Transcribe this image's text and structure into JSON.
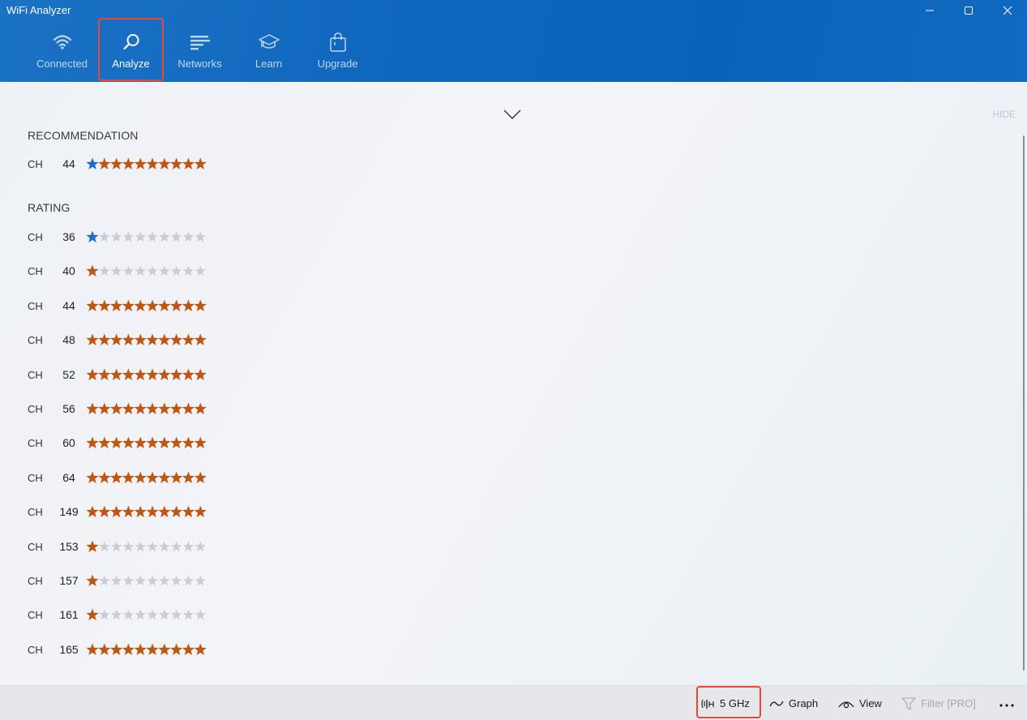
{
  "app": {
    "title": "WiFi Analyzer"
  },
  "window_controls": {
    "minimize_icon": "minimize-icon",
    "maximize_icon": "maximize-icon",
    "close_icon": "close-icon"
  },
  "nav": {
    "items": [
      {
        "label": "Connected",
        "icon": "wifi-icon"
      },
      {
        "label": "Analyze",
        "icon": "magnifier-icon",
        "active": true
      },
      {
        "label": "Networks",
        "icon": "networks-icon"
      },
      {
        "label": "Learn",
        "icon": "mortarboard-icon"
      },
      {
        "label": "Upgrade",
        "icon": "shopping-bag-icon"
      }
    ]
  },
  "content": {
    "hide_label": "HIDE",
    "recommendation": {
      "title": "RECOMMENDATION",
      "ch_label": "CH",
      "channel": "44",
      "rating": 10
    },
    "rating": {
      "title": "RATING",
      "ch_label": "CH",
      "rows": [
        {
          "channel": "36",
          "rating": 1
        },
        {
          "channel": "40",
          "rating": 1
        },
        {
          "channel": "44",
          "rating": 10
        },
        {
          "channel": "48",
          "rating": 10
        },
        {
          "channel": "52",
          "rating": 10
        },
        {
          "channel": "56",
          "rating": 10
        },
        {
          "channel": "60",
          "rating": 10
        },
        {
          "channel": "64",
          "rating": 10
        },
        {
          "channel": "149",
          "rating": 10
        },
        {
          "channel": "153",
          "rating": 1
        },
        {
          "channel": "157",
          "rating": 1
        },
        {
          "channel": "161",
          "rating": 1
        },
        {
          "channel": "165",
          "rating": 10
        }
      ]
    },
    "max_stars": 10
  },
  "bottom_bar": {
    "band": {
      "label": "5 GHz",
      "icon": "antenna-icon"
    },
    "graph": {
      "label": "Graph",
      "icon": "graph-wave-icon"
    },
    "view": {
      "label": "View",
      "icon": "eye-icon"
    },
    "filter": {
      "label": "Filter [PRO]",
      "icon": "filter-icon"
    },
    "more": {
      "icon": "more-dots-icon"
    }
  },
  "colors": {
    "header_blue": "#0f66bd",
    "star_orange": "#c0560f",
    "star_blue": "#1d6ec5",
    "star_gray": "#cbcdd1",
    "highlight_red": "#e8483c"
  }
}
